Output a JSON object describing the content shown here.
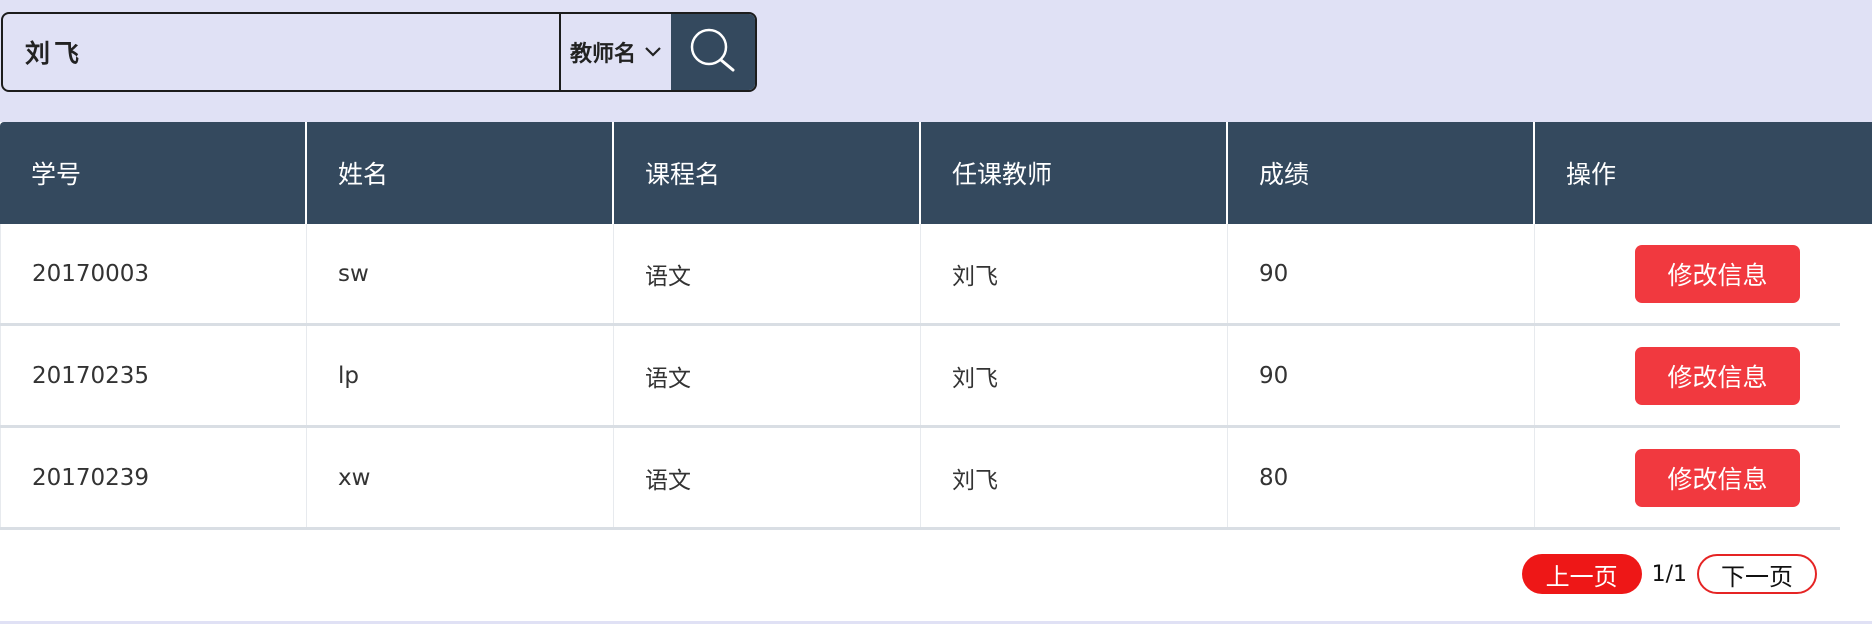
{
  "search": {
    "value": "刘飞",
    "select_label": "教师名",
    "icons": {
      "dropdown": "chevron-down-icon",
      "search": "search-icon"
    }
  },
  "table": {
    "headers": [
      "学号",
      "姓名",
      "课程名",
      "任课教师",
      "成绩",
      "操作"
    ],
    "rows": [
      {
        "id": "20170003",
        "name": "sw",
        "course": "语文",
        "teacher": "刘飞",
        "score": "90",
        "action": "修改信息"
      },
      {
        "id": "20170235",
        "name": "lp",
        "course": "语文",
        "teacher": "刘飞",
        "score": "90",
        "action": "修改信息"
      },
      {
        "id": "20170239",
        "name": "xw",
        "course": "语文",
        "teacher": "刘飞",
        "score": "80",
        "action": "修改信息"
      }
    ]
  },
  "pagination": {
    "prev_label": "上一页",
    "page_info": "1/1",
    "next_label": "下一页"
  },
  "colors": {
    "page_bg": "#e0e1f5",
    "header_bg": "#34495e",
    "button_red": "#f1393f",
    "prev_red": "#ee1717"
  }
}
